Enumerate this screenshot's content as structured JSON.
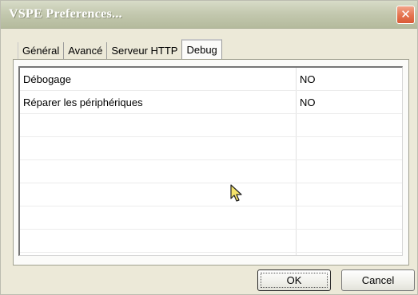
{
  "window": {
    "title": "VSPE Preferences...",
    "close_icon": "close-icon"
  },
  "tabs": [
    {
      "label": "Général",
      "active": false
    },
    {
      "label": "Avancé",
      "active": false
    },
    {
      "label": "Serveur HTTP",
      "active": false
    },
    {
      "label": "Debug",
      "active": true
    }
  ],
  "list": {
    "rows": [
      {
        "name": "Débogage",
        "value": "NO"
      },
      {
        "name": "Réparer les périphériques",
        "value": "NO"
      },
      {
        "name": "",
        "value": ""
      },
      {
        "name": "",
        "value": ""
      },
      {
        "name": "",
        "value": ""
      },
      {
        "name": "",
        "value": ""
      },
      {
        "name": "",
        "value": ""
      },
      {
        "name": "",
        "value": ""
      }
    ]
  },
  "buttons": {
    "ok_label": "OK",
    "cancel_label": "Cancel"
  },
  "colors": {
    "title_gradient_top": "#d8dcc8",
    "title_gradient_bottom": "#b4ba9c",
    "close_button": "#e4734f",
    "dialog_background": "#ece9d8",
    "cursor_fill": "#f5e36a"
  },
  "icons": {
    "cursor": "mouse-pointer-icon"
  }
}
